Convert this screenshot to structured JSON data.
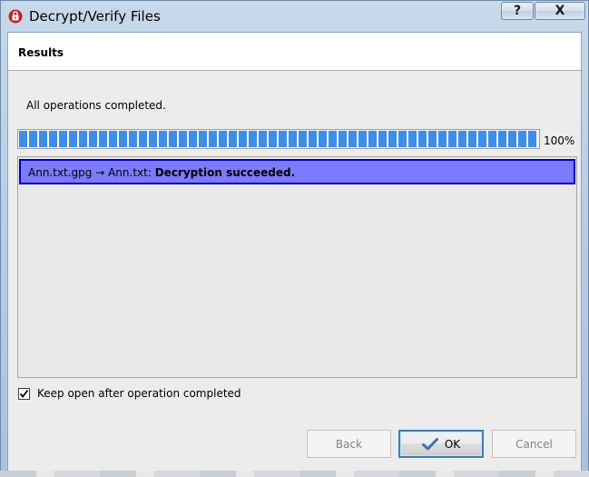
{
  "window": {
    "title": "Decrypt/Verify Files",
    "help_label": "?",
    "close_label": "X"
  },
  "header": {
    "title": "Results"
  },
  "status": {
    "text": "All operations completed."
  },
  "progress": {
    "percent_text": "100%",
    "fraction": 1.0
  },
  "results": [
    {
      "files": "Ann.txt.gpg → Ann.txt:",
      "message": "Decryption succeeded."
    }
  ],
  "keep_open": {
    "label": "Keep open after operation completed",
    "checked": true
  },
  "buttons": {
    "back": "Back",
    "ok": "OK",
    "cancel": "Cancel"
  },
  "colors": {
    "progress_fill": "#3d8ee6",
    "selection_bg": "#7b7bff",
    "selection_border": "#0000b4",
    "ok_icon": "#4a6fa5"
  },
  "icons": {
    "app": "kleopatra-app-icon",
    "ok": "checkmark-icon"
  }
}
